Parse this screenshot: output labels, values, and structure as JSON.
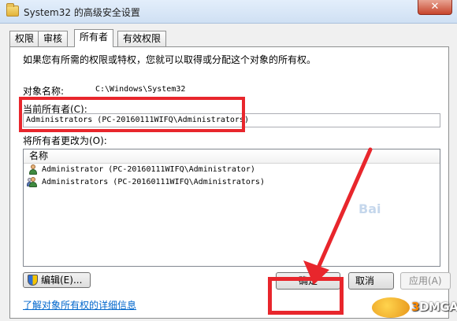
{
  "window": {
    "title": "System32 的高级安全设置",
    "close_glyph": "✕"
  },
  "tabs": [
    {
      "label": "权限"
    },
    {
      "label": "审核"
    },
    {
      "label": "所有者"
    },
    {
      "label": "有效权限"
    }
  ],
  "owner_tab": {
    "description": "如果您有所需的权限或特权，您就可以取得或分配这个对象的所有权。",
    "object_name_label": "对象名称:",
    "object_name_value": "C:\\Windows\\System32",
    "current_owner_label": "当前所有者(C):",
    "current_owner_value": "Administrators (PC-20160111WIFQ\\Administrators)",
    "change_owner_label": "将所有者更改为(O):",
    "list": {
      "column_header": "名称",
      "rows": [
        {
          "name": "Administrator (PC-20160111WIFQ\\Administrator)",
          "icon": "user-icon"
        },
        {
          "name": "Administrators (PC-20160111WIFQ\\Administrators)",
          "icon": "users-group-icon"
        }
      ]
    },
    "edit_button": "编辑(E)...",
    "details_link": "了解对象所有权的详细信息"
  },
  "footer": {
    "ok": "确定",
    "cancel": "取消",
    "apply": "应用(A)"
  },
  "watermark": {
    "brand_num": "3",
    "brand_text": "DMGAME",
    "baidu": "Bai"
  },
  "colors": {
    "annotation_red": "#e8262c",
    "link_blue": "#0066cc"
  }
}
